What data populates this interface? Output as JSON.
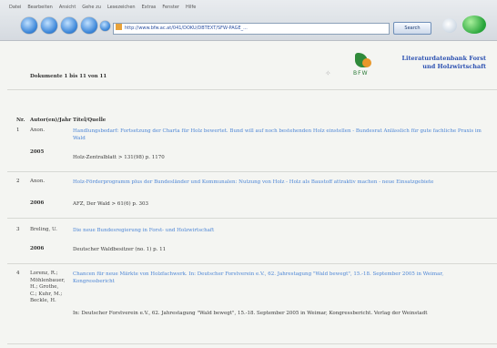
{
  "browser": {
    "menu": [
      "Datei",
      "Bearbeiten",
      "Ansicht",
      "Gehe zu",
      "Lesezeichen",
      "Extras",
      "Fenster",
      "Hilfe"
    ],
    "url": "http://www.bfw.ac.at/041/DOKU/DBTEXT/SFW-PAGE_...",
    "search_label": "Search"
  },
  "header": {
    "count": "Dokumente 1 bis 11 von 11",
    "logo_text": "BFW",
    "db_title_line1": "Literaturdatenbank Forst",
    "db_title_line2": "und Holzwirtschaft"
  },
  "table": {
    "headers": {
      "nr": "Nr.",
      "author": "Autor(en)/Jahr",
      "title": "Titel/Quelle"
    },
    "rows": [
      {
        "nr": "1",
        "author": "Anon.",
        "year": "2005",
        "title": "Handlungsbedarf: Fortsetzung der Charta für Holz bewertet. Bund will auf noch bestehenden Holz einstellen - Bundesrat Anlässlich für gute fachliche Praxis im Wald",
        "source": "Holz-Zentralblatt > 131(98) p. 1170"
      },
      {
        "nr": "2",
        "author": "Anon.",
        "year": "2006",
        "title": "Holz-Förderprogramm plus der Bundesländer und Kommunalen: Nutzung von Holz - Holz als Baustoff attraktiv machen - neue Einsatzgebiete",
        "source": "AFZ, Der Wald > 61(6) p. 303"
      },
      {
        "nr": "3",
        "author": "Breling, U.",
        "year": "2006",
        "title": "Die neue Bundesregierung in Forst- und Holzwirtschaft",
        "source": "Deutscher Waldbesitzer (no. 1) p. 11"
      },
      {
        "nr": "4",
        "author": "Lorenz, R.; Möhlenbauer, H.; Grothe, C.; Kuhr, M.; Beckle, H.",
        "year": "",
        "title": "Chancen für neue Märkte von Holzfachwerk. In: Deutscher Forstverein e.V., 62. Jahrestagung \"Wald bewegt\", 15.-18. September 2005 in Weimar, Kongressbericht",
        "source": "In: Deutscher Forstverein e.V., 62. Jahrestagung \"Wald bewegt\", 15.-18. September 2005 in Weimar, Kongressbericht. Verlag der Weinstadt"
      }
    ]
  }
}
